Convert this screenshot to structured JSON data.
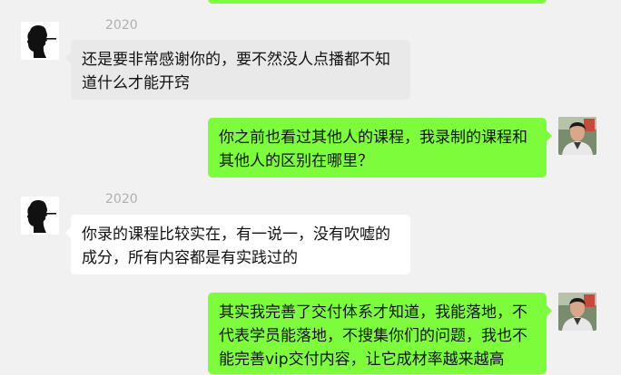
{
  "colors": {
    "background": "#f1f1f1",
    "incoming_bubble": "#ffffff",
    "incoming_bubble_highlighted": "#e9e9e9",
    "outgoing_bubble": "#7dfc3b",
    "sender_name": "#b0b0b0"
  },
  "messages": [
    {
      "direction": "incoming",
      "sender": "2020",
      "avatar_icon": "silhouette-smoking-avatar-icon",
      "lines": [
        "还是要非常感谢你的，要不然没人点播都不知",
        "道什么才能开窍"
      ]
    },
    {
      "direction": "outgoing",
      "avatar_icon": "user-photo-avatar-icon",
      "lines": [
        "你之前也看过其他人的课程，我录制的课程和",
        "其他人的区别在哪里？"
      ]
    },
    {
      "direction": "incoming",
      "sender": "2020",
      "avatar_icon": "silhouette-smoking-avatar-icon",
      "lines": [
        "你录的课程比较实在，有一说一，没有吹嘘的",
        "成分，所有内容都是有实践过的"
      ]
    },
    {
      "direction": "outgoing",
      "avatar_icon": "user-photo-avatar-icon",
      "lines": [
        "其实我完善了交付体系才知道，我能落地，不",
        "代表学员能落地，不搜集你们的问题，我也不",
        "能完善vip交付内容，让它成材率越来越高"
      ]
    }
  ]
}
